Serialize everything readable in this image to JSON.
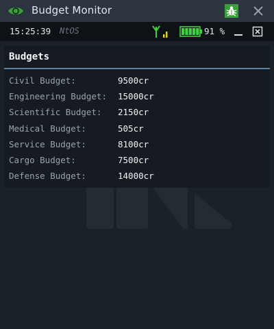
{
  "window": {
    "title": "Budget Monitor",
    "icon": "eye-icon",
    "buttons": {
      "bug": "bug-icon",
      "close": "close-icon"
    }
  },
  "statusbar": {
    "time": "15:25:39",
    "os": "NtOS",
    "signal_icon": "antenna-signal-icon",
    "battery_icon": "battery-icon",
    "battery": "91 %",
    "battery_level": 0.91,
    "buttons": {
      "minimize": "minimize-icon",
      "close": "close-box-icon"
    }
  },
  "panel": {
    "title": "Budgets",
    "rows": [
      {
        "label": "Civil Budget:",
        "value": "9500cr"
      },
      {
        "label": "Engineering Budget:",
        "value": "15000cr"
      },
      {
        "label": "Scientific Budget:",
        "value": "2150cr"
      },
      {
        "label": "Medical Budget:",
        "value": "505cr"
      },
      {
        "label": "Service Budget:",
        "value": "8100cr"
      },
      {
        "label": "Cargo Budget:",
        "value": "7500cr"
      },
      {
        "label": "Defense Budget:",
        "value": "14000cr"
      }
    ]
  },
  "colors": {
    "accent": "#5f7fa6",
    "titlebar": "#2c3440",
    "background": "#1b2128",
    "battery_green": "#3fd13f",
    "signal_green": "#3fd13f",
    "signal_yellow": "#d6d42a"
  }
}
